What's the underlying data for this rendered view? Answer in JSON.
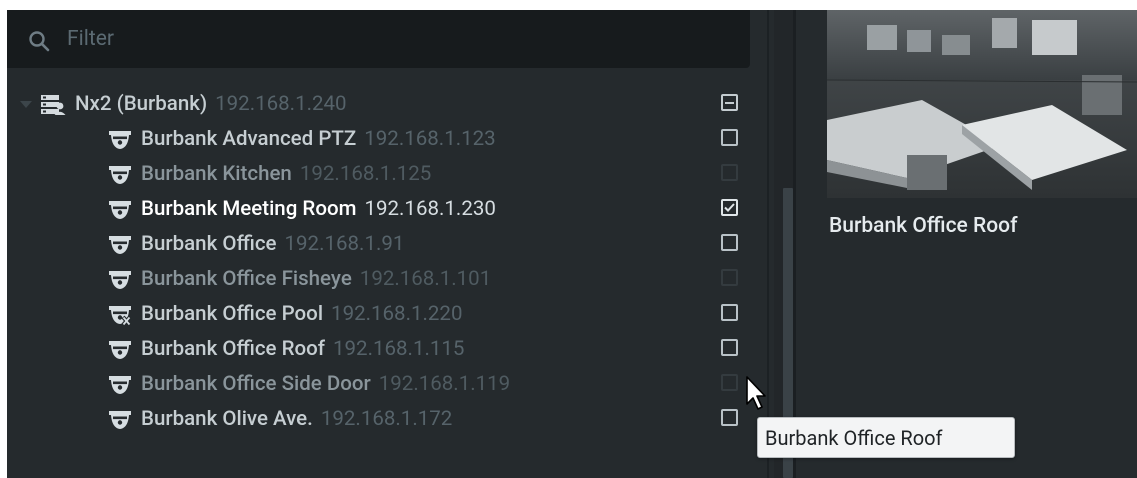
{
  "filter": {
    "placeholder": "Filter",
    "icon": "search-icon"
  },
  "server": {
    "name": "Nx2 (Burbank)",
    "ip": "192.168.1.240",
    "icon": "server-icon",
    "checkbox_state": "partial"
  },
  "cameras": [
    {
      "name": "Burbank Advanced PTZ",
      "ip": "192.168.1.123",
      "checked": false,
      "style": "normal"
    },
    {
      "name": "Burbank Kitchen",
      "ip": "192.168.1.125",
      "checked": false,
      "style": "dim"
    },
    {
      "name": "Burbank Meeting Room",
      "ip": "192.168.1.230",
      "checked": true,
      "style": "bright"
    },
    {
      "name": "Burbank Office",
      "ip": "192.168.1.91",
      "checked": false,
      "style": "normal"
    },
    {
      "name": "Burbank Office Fisheye",
      "ip": "192.168.1.101",
      "checked": false,
      "style": "dim"
    },
    {
      "name": "Burbank Office Pool",
      "ip": "192.168.1.220",
      "checked": false,
      "style": "normal"
    },
    {
      "name": "Burbank Office Roof",
      "ip": "192.168.1.115",
      "checked": false,
      "style": "normal"
    },
    {
      "name": "Burbank Office Side Door",
      "ip": "192.168.1.119",
      "checked": false,
      "style": "dim"
    },
    {
      "name": "Burbank Olive Ave.",
      "ip": "192.168.1.172",
      "checked": false,
      "style": "normal"
    }
  ],
  "preview": {
    "title": "Burbank Office Roof"
  },
  "tooltip": {
    "text": "Burbank Office Roof"
  },
  "colors": {
    "background": "#252a2d",
    "filter_bg": "#171b1d",
    "text_bright": "#ffffff"
  }
}
